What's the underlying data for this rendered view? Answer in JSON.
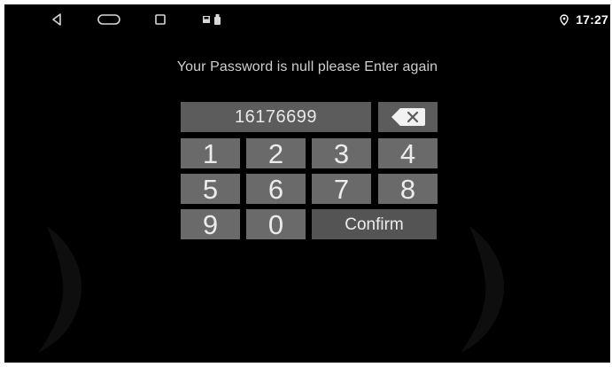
{
  "status_bar": {
    "nav_back_icon": "triangle-back-icon",
    "nav_home_icon": "pill-home-icon",
    "nav_recents_icon": "square-recents-icon",
    "notification_icons": [
      "sd-card-icon",
      "usb-icon"
    ],
    "location_icon": "location-pin-icon",
    "time": "17:27"
  },
  "prompt": "Your Password is null please Enter again",
  "input": {
    "value": "16176699",
    "backspace_icon": "backspace-icon"
  },
  "keypad": {
    "row1": [
      "1",
      "2",
      "3",
      "4"
    ],
    "row2": [
      "5",
      "6",
      "7",
      "8"
    ],
    "row3": [
      "9",
      "0"
    ],
    "confirm_label": "Confirm"
  },
  "colors": {
    "background": "#000000",
    "key": "#6a6a6a",
    "display": "#5c5c5c",
    "confirm": "#545454",
    "text": "#ececec"
  }
}
